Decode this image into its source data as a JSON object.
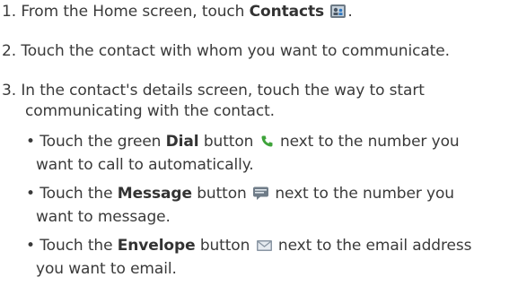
{
  "steps": [
    {
      "number": "1.",
      "pre": "From the Home screen, touch",
      "bold": "Contacts",
      "post": "."
    },
    {
      "number": "2.",
      "text": "Touch the contact with whom you want to communicate."
    },
    {
      "number": "3.",
      "line1": "In the contact's details screen, touch the way to start",
      "line2": "communicating with the contact."
    }
  ],
  "bullets": [
    {
      "marker": "•",
      "pre": "Touch the green",
      "bold": "Dial",
      "mid": "button",
      "line1_end": "next to the number you",
      "line2": "want to call to automatically.",
      "icon": "phone-icon",
      "icon_color": "#3ea33a"
    },
    {
      "marker": "•",
      "pre": "Touch the",
      "bold": "Message",
      "mid": "button",
      "line1_end": "next to the number you",
      "line2": "want to message.",
      "icon": "message-icon",
      "icon_color": "#6f7c88"
    },
    {
      "marker": "•",
      "pre": "Touch the",
      "bold": "Envelope",
      "mid": "button",
      "line1_end": "next to the email address",
      "line2": "you want to email.",
      "icon": "envelope-icon",
      "icon_color": "#8a96a3"
    }
  ],
  "contacts_icon": "contacts-icon"
}
